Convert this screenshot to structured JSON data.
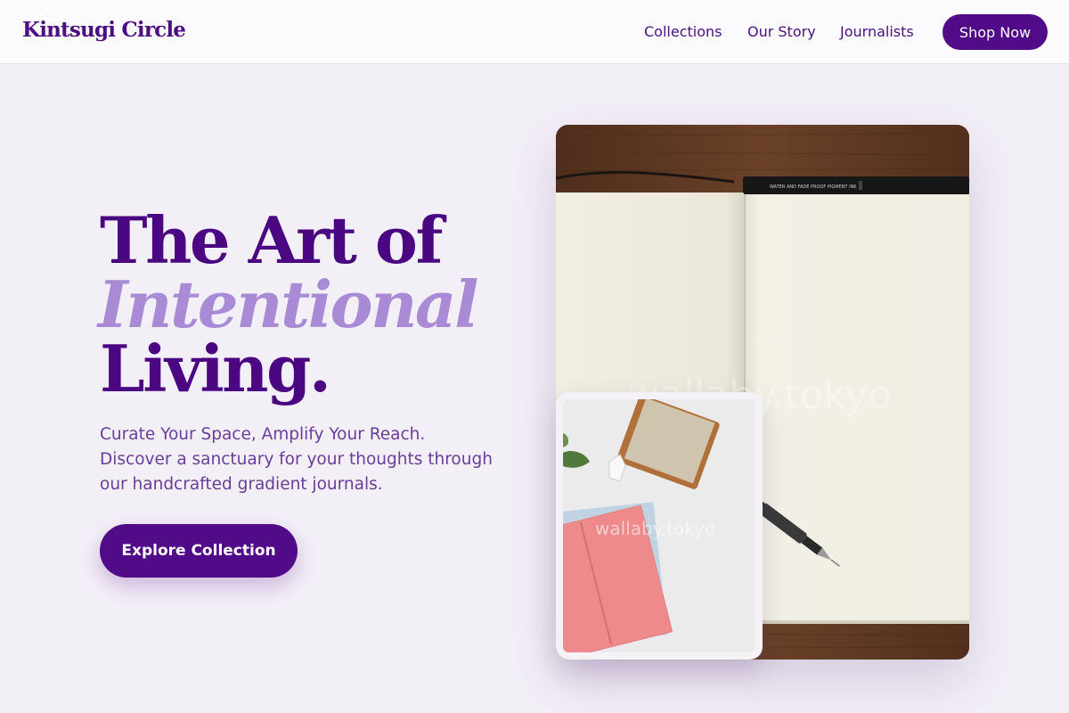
{
  "header": {
    "brand": "Kintsugi Circle",
    "nav": [
      "Collections",
      "Our Story",
      "Journalists"
    ],
    "cta": "Shop Now"
  },
  "hero": {
    "headline_line1": "The Art of",
    "headline_line2": "Intentional",
    "headline_line3": "Living.",
    "subtitle_lines": [
      "Curate Your Space, Amplify Your Reach.",
      "Discover a sanctuary for your thoughts through",
      "our handcrafted gradient journals."
    ],
    "cta": "Explore Collection"
  },
  "images": {
    "main_watermark": "wallaby.tokyo",
    "inset_watermark": "wallaby.tokyo",
    "pen_print": "WATER AND FADE PROOF PIGMENT INK"
  },
  "colors": {
    "primary": "#520b88",
    "accent_light": "#a98bd5",
    "background": "#f3eff7"
  }
}
